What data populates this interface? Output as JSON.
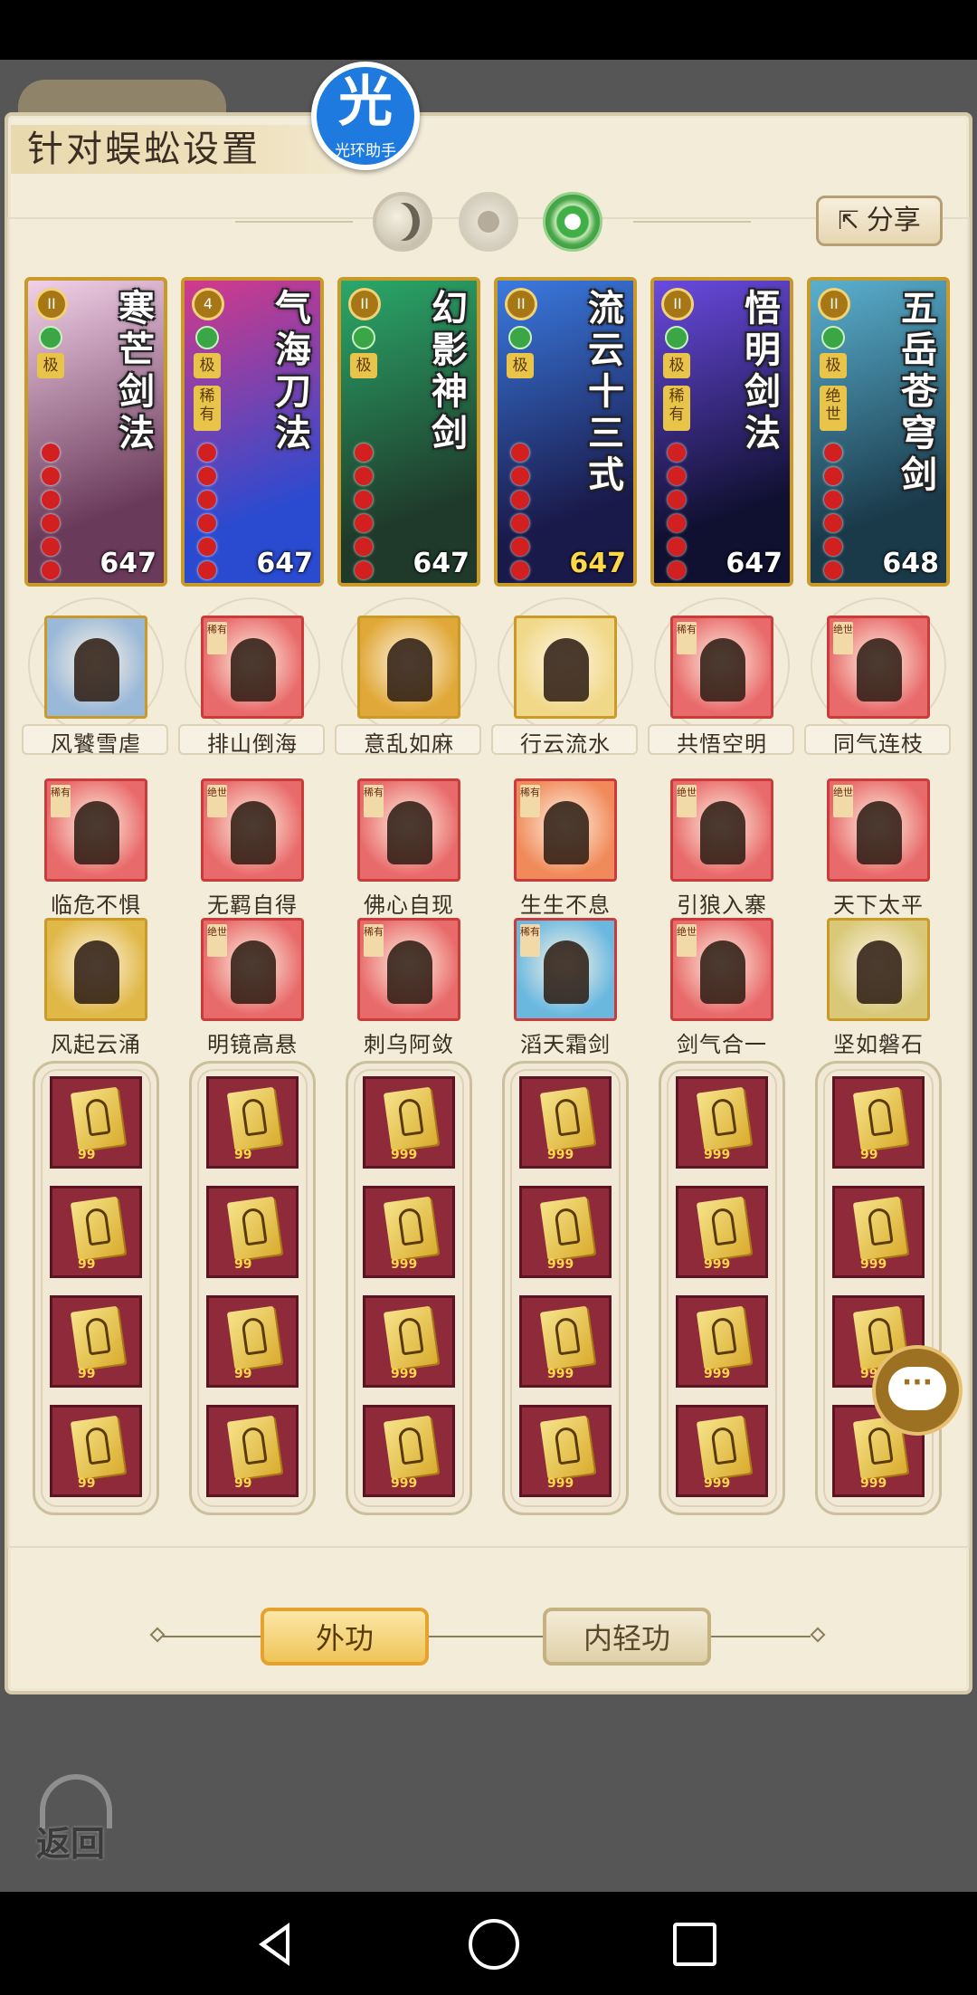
{
  "panel": {
    "title": "针对蜈蚣设置",
    "logo_char": "光",
    "logo_text": "光环助手",
    "share_label": "分享",
    "share_icon": "share-arrow-icon"
  },
  "cards": [
    {
      "name": "寒芒剑法",
      "level": "647",
      "badge": "II",
      "tag1": "极",
      "tag2": "",
      "colors": [
        "#f2d0e8",
        "#6a3a5a"
      ]
    },
    {
      "name": "气海刀法",
      "level": "647",
      "badge": "4",
      "tag1": "极",
      "tag2": "稀有",
      "colors": [
        "#d23a8a",
        "#2a4ad0"
      ]
    },
    {
      "name": "幻影神剑",
      "level": "647",
      "badge": "II",
      "tag1": "极",
      "tag2": "",
      "colors": [
        "#2aa86a",
        "#1f3a2a"
      ]
    },
    {
      "name": "流云十三式",
      "level": "647",
      "badge": "II",
      "tag1": "极",
      "tag2": "",
      "colors": [
        "#3a7ae0",
        "#1a1a4a"
      ]
    },
    {
      "name": "悟明剑法",
      "level": "647",
      "badge": "II",
      "tag1": "极",
      "tag2": "稀有",
      "colors": [
        "#6a4ae0",
        "#101030"
      ]
    },
    {
      "name": "五岳苍穹剑",
      "level": "648",
      "badge": "II",
      "tag1": "极",
      "tag2": "绝世",
      "colors": [
        "#5ab0d0",
        "#1a3a4a"
      ]
    }
  ],
  "skill_rows": [
    [
      {
        "label": "风饕雪虐",
        "tag": "",
        "gold": true,
        "color": "#9ab8d8"
      },
      {
        "label": "排山倒海",
        "tag": "稀有",
        "gold": false,
        "color": "#e86a6a"
      },
      {
        "label": "意乱如麻",
        "tag": "",
        "gold": true,
        "color": "#e0a838"
      },
      {
        "label": "行云流水",
        "tag": "",
        "gold": true,
        "color": "#f0d888"
      },
      {
        "label": "共悟空明",
        "tag": "稀有",
        "gold": false,
        "color": "#e86a6a"
      },
      {
        "label": "同气连枝",
        "tag": "绝世",
        "gold": false,
        "color": "#e86a6a"
      }
    ],
    [
      {
        "label": "临危不惧",
        "tag": "稀有",
        "gold": false,
        "color": "#e86a6a"
      },
      {
        "label": "无羁自得",
        "tag": "绝世",
        "gold": false,
        "color": "#e86a6a"
      },
      {
        "label": "佛心自现",
        "tag": "稀有",
        "gold": false,
        "color": "#e86a6a"
      },
      {
        "label": "生生不息",
        "tag": "稀有",
        "gold": false,
        "color": "#f08a5a"
      },
      {
        "label": "引狼入寨",
        "tag": "绝世",
        "gold": false,
        "color": "#e86a6a"
      },
      {
        "label": "天下太平",
        "tag": "绝世",
        "gold": false,
        "color": "#e86a6a"
      }
    ],
    [
      {
        "label": "风起云涌",
        "tag": "",
        "gold": true,
        "color": "#e0b848"
      },
      {
        "label": "明镜高悬",
        "tag": "绝世",
        "gold": false,
        "color": "#e86a6a"
      },
      {
        "label": "刺乌阿敛",
        "tag": "稀有",
        "gold": false,
        "color": "#e86a6a"
      },
      {
        "label": "滔天霜剑",
        "tag": "稀有",
        "gold": false,
        "color": "#6ab8e0"
      },
      {
        "label": "剑气合一",
        "tag": "绝世",
        "gold": false,
        "color": "#e86a6a"
      },
      {
        "label": "坚如磐石",
        "tag": "",
        "gold": true,
        "color": "#d8c878"
      }
    ]
  ],
  "secret_columns": [
    [
      "99",
      "99",
      "99",
      "99"
    ],
    [
      "99",
      "99",
      "99",
      "99"
    ],
    [
      "999",
      "999",
      "999",
      "999"
    ],
    [
      "999",
      "999",
      "999",
      "999"
    ],
    [
      "999",
      "999",
      "999",
      "999"
    ],
    [
      "99",
      "999",
      "999",
      "999"
    ]
  ],
  "tabs": {
    "active": "外功",
    "inactive": "内轻功"
  },
  "back_label": "返回",
  "chat_icon_text": "···",
  "icons": {
    "mode_1": "moon-icon",
    "mode_2": "sun-icon",
    "mode_3": "ring-icon",
    "chat": "chat-bubble-icon",
    "back": "back-arrow-icon"
  }
}
